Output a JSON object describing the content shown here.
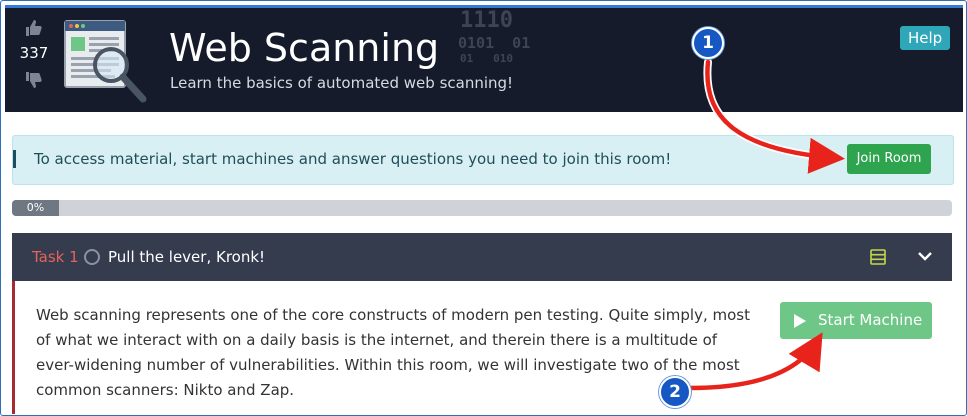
{
  "header": {
    "vote_count": "337",
    "title": "Web Scanning",
    "subtitle": "Learn the basics of automated web scanning!",
    "binary_lines": [
      "1110",
      "0101  01",
      "01   010"
    ],
    "help_label": "Help"
  },
  "join_banner": {
    "text": "To access material, start machines and answer questions you need to join this room!",
    "button_label": "Join Room"
  },
  "progress": {
    "label": "0%",
    "value": 0
  },
  "task": {
    "number_label": "Task 1",
    "title": "Pull the lever, Kronk!",
    "body_text": "Web scanning represents one of the core constructs of modern pen testing. Quite simply, most of what we interact with on a daily basis is the internet, and therein there is a multitude of ever-widening number of vulnerabilities. Within this room, we will investigate two of the most common scanners: Nikto and Zap.",
    "start_machine_label": "Start Machine"
  },
  "annotations": {
    "badge_1": "1",
    "badge_2": "2"
  },
  "colors": {
    "header_bg": "#151b2b",
    "join_green": "#2ea44f",
    "start_green": "#6ec787",
    "task_accent": "#e6625d",
    "arrow_red": "#e8231c",
    "badge_blue": "#1558c4"
  }
}
